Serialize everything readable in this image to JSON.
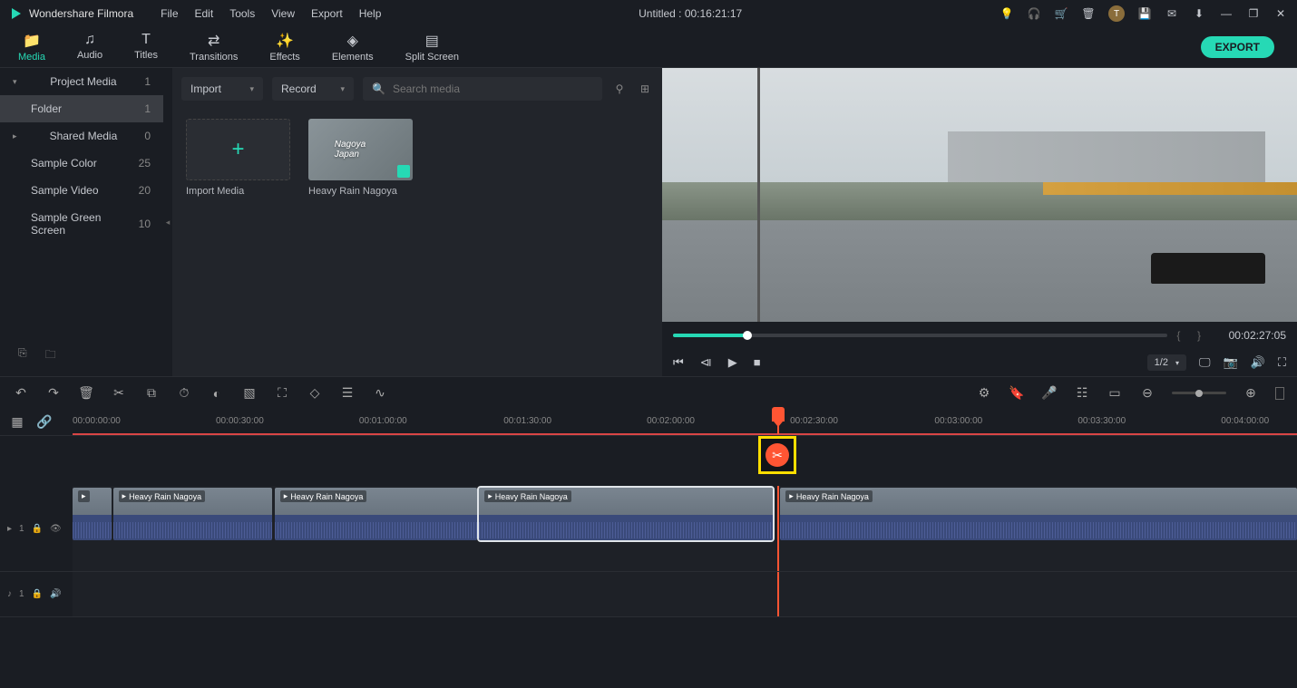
{
  "app": {
    "name": "Wondershare Filmora",
    "title": "Untitled : 00:16:21:17"
  },
  "menu": [
    "File",
    "Edit",
    "Tools",
    "View",
    "Export",
    "Help"
  ],
  "tabs": [
    {
      "label": "Media",
      "icon": "folder"
    },
    {
      "label": "Audio",
      "icon": "music"
    },
    {
      "label": "Titles",
      "icon": "text"
    },
    {
      "label": "Transitions",
      "icon": "transitions"
    },
    {
      "label": "Effects",
      "icon": "effects"
    },
    {
      "label": "Elements",
      "icon": "elements"
    },
    {
      "label": "Split Screen",
      "icon": "split"
    }
  ],
  "export_label": "EXPORT",
  "sidebar": {
    "items": [
      {
        "label": "Project Media",
        "count": "1"
      },
      {
        "label": "Folder",
        "count": "1"
      },
      {
        "label": "Shared Media",
        "count": "0"
      },
      {
        "label": "Sample Color",
        "count": "25"
      },
      {
        "label": "Sample Video",
        "count": "20"
      },
      {
        "label": "Sample Green Screen",
        "count": "10"
      }
    ]
  },
  "media_panel": {
    "import_label": "Import",
    "record_label": "Record",
    "search_placeholder": "Search media",
    "items": [
      {
        "label": "Import Media",
        "type": "import"
      },
      {
        "label": "Heavy Rain Nagoya",
        "type": "video",
        "overlay": "Nagoya Japan"
      }
    ]
  },
  "preview": {
    "timecode": "00:02:27:05",
    "ratio": "1/2"
  },
  "timeline": {
    "marks": [
      "00:00:00:00",
      "00:00:30:00",
      "00:01:00:00",
      "00:01:30:00",
      "00:02:00:00",
      "00:02:30:00",
      "00:03:00:00",
      "00:03:30:00",
      "00:04:00:00"
    ],
    "clips": [
      {
        "label": "Heavy Rain Nagoya"
      },
      {
        "label": "Heavy Rain Nagoya"
      },
      {
        "label": "Heavy Rain Nagoya"
      },
      {
        "label": "Heavy Rain Nagoya"
      }
    ],
    "video_track_label": "1",
    "audio_track_label": "1"
  }
}
